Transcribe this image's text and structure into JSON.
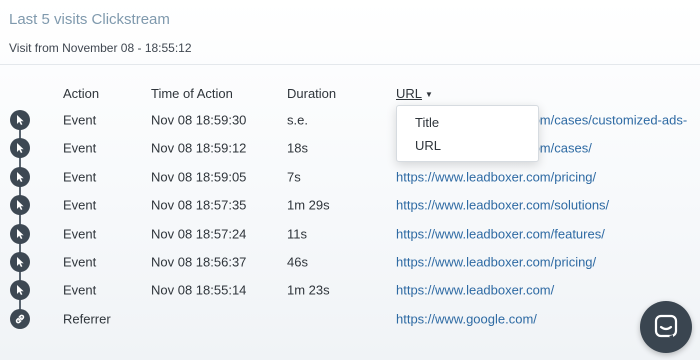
{
  "header": {
    "title": "Last 5 visits Clickstream",
    "subtitle": "Visit from November 08 - 18:55:12"
  },
  "columns": {
    "action": "Action",
    "time": "Time of Action",
    "duration": "Duration",
    "url": "URL"
  },
  "rows": [
    {
      "icon": "cursor-icon",
      "action": "Event",
      "time": "Nov 08 18:59:30",
      "duration": "s.e.",
      "url": "https://www.leadboxer.com/cases/customized-ads-"
    },
    {
      "icon": "cursor-icon",
      "action": "Event",
      "time": "Nov 08 18:59:12",
      "duration": "18s",
      "url": "https://www.leadboxer.com/cases/"
    },
    {
      "icon": "cursor-icon",
      "action": "Event",
      "time": "Nov 08 18:59:05",
      "duration": "7s",
      "url": "https://www.leadboxer.com/pricing/"
    },
    {
      "icon": "cursor-icon",
      "action": "Event",
      "time": "Nov 08 18:57:35",
      "duration": "1m 29s",
      "url": "https://www.leadboxer.com/solutions/"
    },
    {
      "icon": "cursor-icon",
      "action": "Event",
      "time": "Nov 08 18:57:24",
      "duration": "11s",
      "url": "https://www.leadboxer.com/features/"
    },
    {
      "icon": "cursor-icon",
      "action": "Event",
      "time": "Nov 08 18:56:37",
      "duration": "46s",
      "url": "https://www.leadboxer.com/pricing/"
    },
    {
      "icon": "cursor-icon",
      "action": "Event",
      "time": "Nov 08 18:55:14",
      "duration": "1m 23s",
      "url": "https://www.leadboxer.com/"
    },
    {
      "icon": "link-icon",
      "action": "Referrer",
      "time": "",
      "duration": "",
      "url": "https://www.google.com/"
    }
  ],
  "dropdown": {
    "options": [
      "Title",
      "URL"
    ]
  },
  "chat": {
    "icon": "chat-icon"
  },
  "colors": {
    "link": "#2e6aa3",
    "icon_bg": "#3d4853",
    "title": "#7f99ad"
  }
}
